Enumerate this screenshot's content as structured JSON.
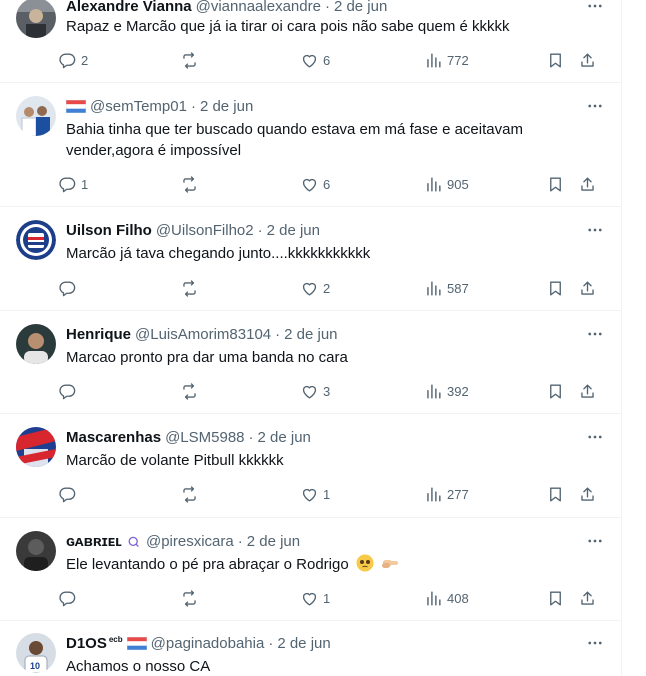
{
  "tweets": [
    {
      "name": "Alexandre Vianna",
      "handle": "@viannaalexandre",
      "time": "2 de jun",
      "text": "Rapaz e Marcão que já ia tirar oi cara pois não sabe quem é kkkkk",
      "replies": "2",
      "retweets": "",
      "likes": "6",
      "views": "772"
    },
    {
      "name": "",
      "handle": "@semTemp01",
      "time": "2 de jun",
      "text": "Bahia tinha que ter buscado quando estava em má fase e aceitavam vender,agora é impossível",
      "replies": "1",
      "retweets": "",
      "likes": "6",
      "views": "905"
    },
    {
      "name": "Uilson Filho",
      "handle": "@UilsonFilho2",
      "time": "2 de jun",
      "text": "Marcão já tava chegando junto....kkkkkkkkkkk",
      "replies": "",
      "retweets": "",
      "likes": "2",
      "views": "587"
    },
    {
      "name": "Henrique",
      "handle": "@LuisAmorim83104",
      "time": "2 de jun",
      "text": "Marcao pronto pra dar uma banda no cara",
      "replies": "",
      "retweets": "",
      "likes": "3",
      "views": "392"
    },
    {
      "name": "Mascarenhas",
      "handle": "@LSM5988",
      "time": "2 de jun",
      "text": "Marcão de volante Pitbull kkkkkk",
      "replies": "",
      "retweets": "",
      "likes": "1",
      "views": "277"
    },
    {
      "name": "ɢᴀʙʀɪᴇʟ",
      "handle": "@piresxicara",
      "time": "2 de jun",
      "text": "Ele levantando o pé pra abraçar o Rodrigo",
      "replies": "",
      "retweets": "",
      "likes": "1",
      "views": "408"
    },
    {
      "name": "D1OS",
      "name_sup": "ecb",
      "handle": "@paginadobahia",
      "time": "2 de jun",
      "text": "Achamos o nosso CA",
      "replies": "",
      "retweets": "",
      "likes": "",
      "views": ""
    }
  ],
  "separator": "·",
  "icons": {
    "reply": "reply-icon",
    "retweet": "retweet-icon",
    "like": "heart-icon",
    "views": "views-chart-icon",
    "bookmark": "bookmark-icon",
    "share": "share-icon",
    "more": "more-options-icon"
  },
  "colors": {
    "text": "#0f1419",
    "secondary": "#536471",
    "border": "#eff3f4"
  }
}
